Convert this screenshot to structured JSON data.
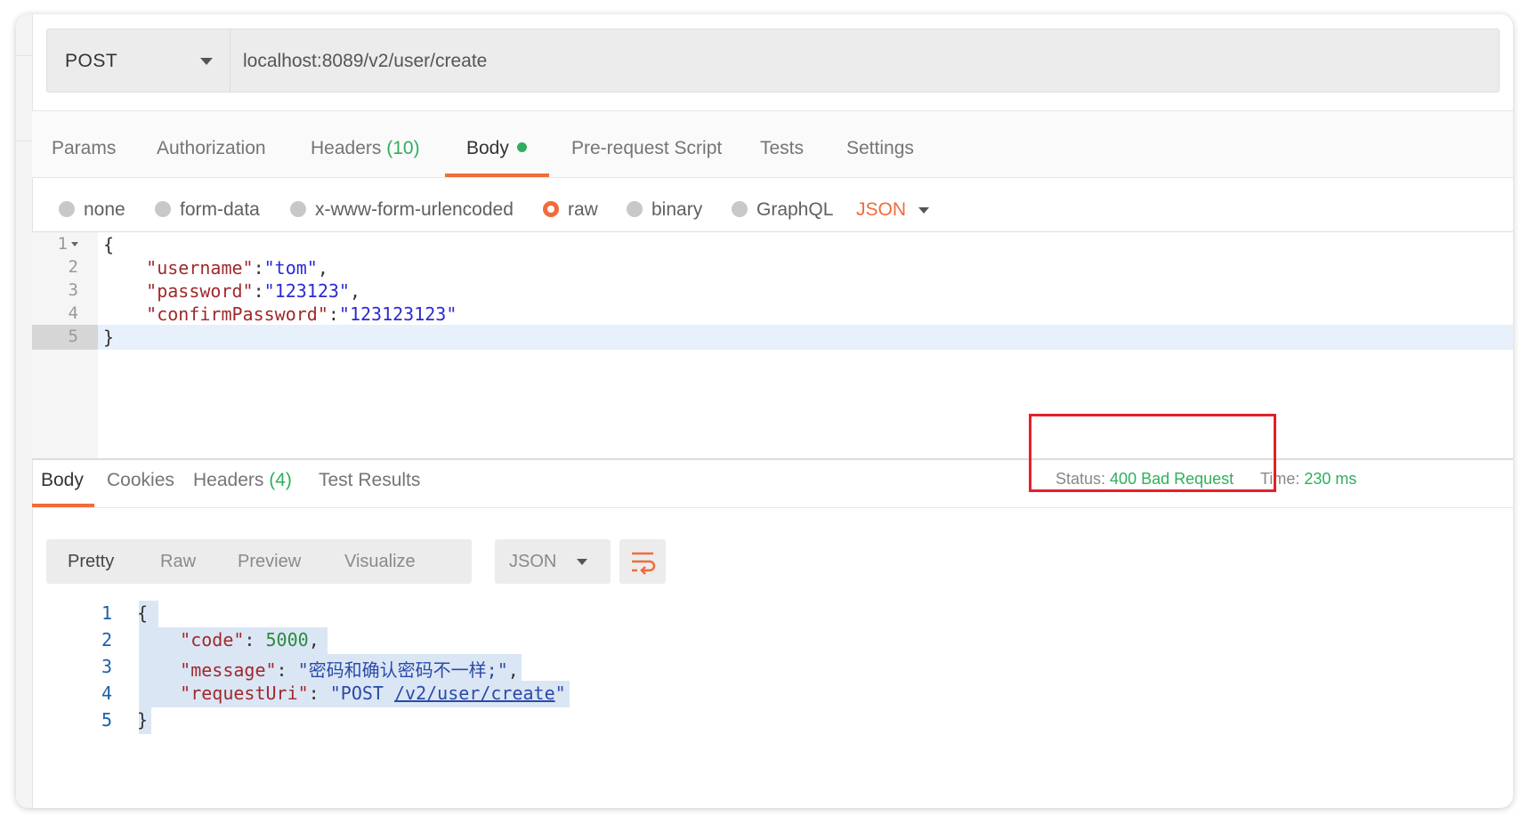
{
  "request": {
    "method": "POST",
    "url": "localhost:8089/v2/user/create"
  },
  "request_tabs": [
    {
      "label": "Params"
    },
    {
      "label": "Authorization"
    },
    {
      "label": "Headers",
      "count": "(10)"
    },
    {
      "label": "Body",
      "active": true
    },
    {
      "label": "Pre-request Script"
    },
    {
      "label": "Tests"
    },
    {
      "label": "Settings"
    }
  ],
  "body_types": [
    "none",
    "form-data",
    "x-www-form-urlencoded",
    "raw",
    "binary",
    "GraphQL"
  ],
  "body_type_selected": "raw",
  "body_format": "JSON",
  "request_body": {
    "line_numbers": [
      "1",
      "2",
      "3",
      "4",
      "5"
    ],
    "open_brace": "{",
    "close_brace": "}",
    "fields": [
      {
        "key": "\"username\"",
        "value": "\"tom\"",
        "sep": ":",
        "trail": ","
      },
      {
        "key": "\"password\"",
        "value": "\"123123\"",
        "sep": ":",
        "trail": ","
      },
      {
        "key": "\"confirmPassword\"",
        "value": "\"123123123\"",
        "sep": ":",
        "trail": ""
      }
    ]
  },
  "response_tabs": [
    {
      "label": "Body",
      "active": true
    },
    {
      "label": "Cookies"
    },
    {
      "label": "Headers",
      "count": "(4)"
    },
    {
      "label": "Test Results"
    }
  ],
  "status": {
    "status_label": "Status:",
    "status_value": "400 Bad Request",
    "time_label": "Time:",
    "time_value": "230 ms"
  },
  "view_modes": [
    "Pretty",
    "Raw",
    "Preview",
    "Visualize"
  ],
  "view_mode_selected": "Pretty",
  "response_format": "JSON",
  "response_body": {
    "line_numbers": [
      "1",
      "2",
      "3",
      "4",
      "5"
    ],
    "open_brace": "{",
    "close_brace": "}",
    "code_key": "\"code\"",
    "code_value": "5000",
    "message_key": "\"message\"",
    "message_value": "\"密码和确认密码不一样;\"",
    "requestUri_key": "\"requestUri\"",
    "requestUri_prefix": "\"POST ",
    "requestUri_link": "/v2/user/create",
    "requestUri_suffix": "\""
  },
  "colors": {
    "accent": "#f26b3a",
    "success": "#2fae5e",
    "highlight_box": "#e3202a"
  }
}
